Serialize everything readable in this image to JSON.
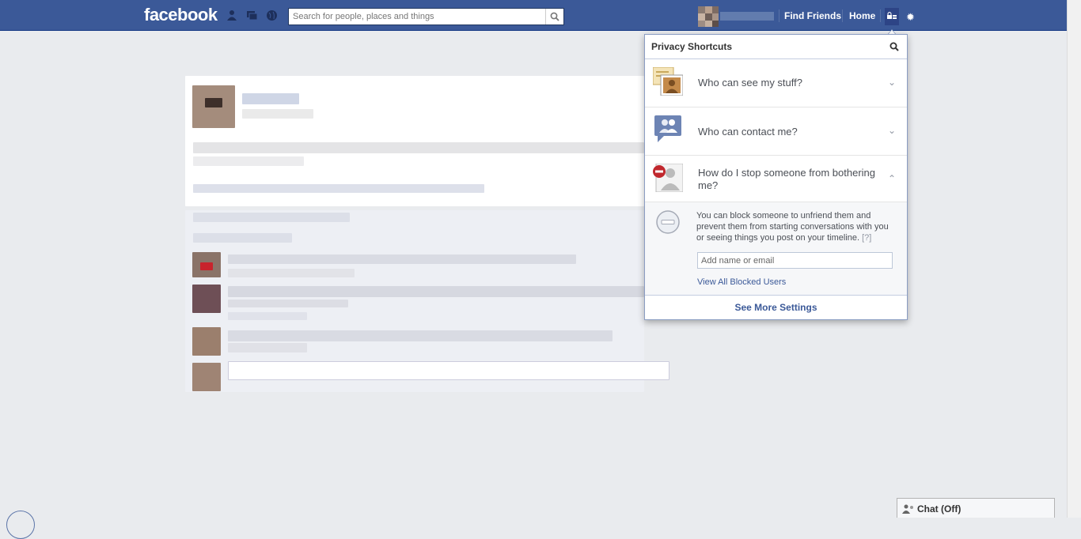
{
  "topbar": {
    "logo": "facebook",
    "search_placeholder": "Search for people, places and things",
    "find_friends": "Find Friends",
    "home": "Home"
  },
  "privacy_panel": {
    "title": "Privacy Shortcuts",
    "sections": [
      {
        "label": "Who can see my stuff?",
        "state": "collapsed"
      },
      {
        "label": "Who can contact me?",
        "state": "collapsed"
      },
      {
        "label": "How do I stop someone from bothering me?",
        "state": "expanded"
      }
    ],
    "block_description": "You can block someone to unfriend them and prevent them from starting conversations with you or seeing things you post on your timeline.",
    "help_marker": "[?]",
    "block_input_placeholder": "Add name or email",
    "view_blocked_link": "View All Blocked Users",
    "see_more": "See More Settings"
  },
  "chat": {
    "label": "Chat (Off)"
  },
  "colors": {
    "brand": "#3b5998",
    "link": "#3b5998",
    "page_bg": "#e9ebee"
  }
}
